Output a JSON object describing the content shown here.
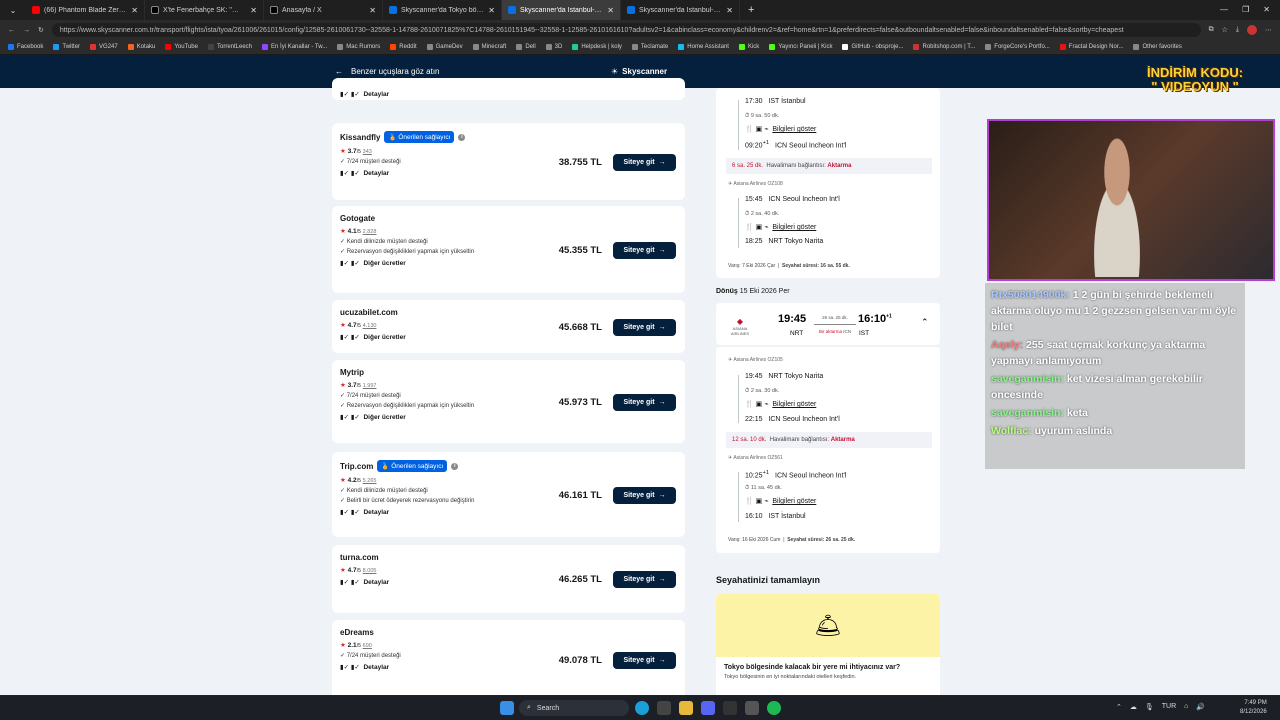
{
  "browser": {
    "tabs": [
      {
        "label": "(66) Phantom Blade Zero - Pre-Or",
        "color": "#ff0000"
      },
      {
        "label": "X'te Fenerbahçe SK: \"🎙️ Yeni tra",
        "color": "#000000"
      },
      {
        "label": "Anasayfa / X",
        "color": "#000000"
      },
      {
        "label": "Skyscanner'da Tokyo bölgesi için",
        "color": "#0770e3"
      },
      {
        "label": "Skyscanner'da İstanbul-Tokyo ara",
        "color": "#0770e3"
      },
      {
        "label": "Skyscanner'da İstanbul-Tokyo ara",
        "color": "#0770e3"
      }
    ],
    "url": "https://www.skyscanner.com.tr/transport/flights/ista/tyoa/261006/261015/config/12585-2610061730--32558-1-14788-2610071825%7C14788-2610151945--32558-1-12585-2610161610?adultsv2=1&cabinclass=economy&childrenv2=&ref=home&rtn=1&preferdirects=false&outboundaltsenabled=false&inboundaltsenabled=false&sortby=cheapest",
    "bookmarks": [
      "Facebook",
      "Twitter",
      "VG247",
      "Kotaku",
      "YouTube",
      "TorrentLeech",
      "En İyi Kanallar - Tw...",
      "Mac Rumors",
      "Reddit",
      "GameDev",
      "Minecraft",
      "Dell",
      "3D",
      "Helpdesk | koly",
      "Teclamate",
      "Home Assistant",
      "Kick",
      "Yayıncı Paneli | Kick",
      "GitHub - obsproje...",
      "Robitshop.com | T...",
      "ForgeCore's Portfo...",
      "Fractal Design Nor...",
      "Other favorites"
    ]
  },
  "header": {
    "back_label": "Benzer uçuşlara göz atın",
    "brand": "Skyscanner"
  },
  "providers": [
    {
      "name": "",
      "badge": "",
      "rating": "",
      "count": "",
      "features": [],
      "details": "Detaylar",
      "price": "",
      "cta": ""
    },
    {
      "name": "Kissandfly",
      "badge": "Önerilen sağlayıcı",
      "rating": "3.7",
      "count": "343",
      "features": [
        "7/24 müşteri desteği"
      ],
      "details": "Detaylar",
      "price": "38.755 TL",
      "cta": "Siteye git"
    },
    {
      "name": "Gotogate",
      "badge": "",
      "rating": "4.1",
      "count": "2.828",
      "features": [
        "Kendi dilinizde müşteri desteği",
        "Rezervasyon değişiklikleri yapmak için yükseltin"
      ],
      "details": "Diğer ücretler",
      "price": "45.355 TL",
      "cta": "Siteye git"
    },
    {
      "name": "ucuzabilet.com",
      "badge": "",
      "rating": "4.7",
      "count": "4.130",
      "features": [],
      "details": "Diğer ücretler",
      "price": "45.668 TL",
      "cta": "Siteye git"
    },
    {
      "name": "Mytrip",
      "badge": "",
      "rating": "3.7",
      "count": "1.997",
      "features": [
        "7/24 müşteri desteği",
        "Rezervasyon değişiklikleri yapmak için yükseltin"
      ],
      "details": "Diğer ücretler",
      "price": "45.973 TL",
      "cta": "Siteye git"
    },
    {
      "name": "Trip.com",
      "badge": "Önerilen sağlayıcı",
      "rating": "4.2",
      "count": "5.265",
      "features": [
        "Kendi dilinizde müşteri desteği",
        "Belirli bir ücret ödeyerek rezervasyonu değiştirin"
      ],
      "details": "Detaylar",
      "price": "46.161 TL",
      "cta": "Siteye git"
    },
    {
      "name": "turna.com",
      "badge": "",
      "rating": "4.7",
      "count": "8.005",
      "features": [],
      "details": "Detaylar",
      "price": "46.265 TL",
      "cta": "Siteye git"
    },
    {
      "name": "eDreams",
      "badge": "",
      "rating": "2.1",
      "count": "690",
      "features": [
        "7/24 müşteri desteği"
      ],
      "details": "Detaylar",
      "price": "49.078 TL",
      "cta": "Siteye git"
    }
  ],
  "rating_suffix": "/5",
  "outbound": {
    "seg1": {
      "dep_time": "17:30",
      "dep": "IST İstanbul",
      "dur": "9 sa. 50 dk.",
      "info": "Bilgileri göster",
      "arr_time": "09:20",
      "arr_sup": "+1",
      "arr": "ICN Seoul Incheon Int'l"
    },
    "conn": {
      "time": "6 sa. 25 dk.",
      "label": "Havalimanı bağlantısı",
      "type": "Aktarma"
    },
    "seg2": {
      "airline": "Asiana Airlines OZ108",
      "dep_time": "15:45",
      "dep": "ICN Seoul Incheon Int'l",
      "dur": "2 sa. 40 dk.",
      "info": "Bilgileri göster",
      "arr_time": "18:25",
      "arr": "NRT Tokyo Narita"
    },
    "footer_arr": "Varış: 7 Eki 2026 Çar",
    "footer_dur": "Seyahat süresi: 16 sa. 55 dk."
  },
  "inbound": {
    "title": "Dönüş",
    "date": "15 Eki 2026 Per",
    "summary": {
      "dep_time": "19:45",
      "dep": "NRT",
      "dur": "26 sa. 25 dk.",
      "stops": "Bir aktarma",
      "via": "ICN",
      "arr_time": "16:10",
      "arr_sup": "+1",
      "arr": "IST",
      "logo": "ASIANA AIRLINES"
    },
    "seg1": {
      "airline": "Asiana Airlines OZ105",
      "dep_time": "19:45",
      "dep": "NRT Tokyo Narita",
      "dur": "2 sa. 30 dk.",
      "info": "Bilgileri göster",
      "arr_time": "22:15",
      "arr": "ICN Seoul Incheon Int'l"
    },
    "conn": {
      "time": "12 sa. 10 dk.",
      "label": "Havalimanı bağlantısı",
      "type": "Aktarma"
    },
    "seg2": {
      "airline": "Asiana Airlines OZ561",
      "dep_time": "10:25",
      "dep_sup": "+1",
      "dep": "ICN Seoul Incheon Int'l",
      "dur": "11 sa. 45 dk.",
      "info": "Bilgileri göster",
      "arr_time": "16:10",
      "arr": "IST İstanbul"
    },
    "footer_arr": "Varış: 16 Eki 2026 Cum",
    "footer_dur": "Seyahat süresi: 26 sa. 25 dk."
  },
  "promo": {
    "section": "Seyahatinizi tamamlayın",
    "title": "Tokyo bölgesinde kalacak bir yere mi ihtiyacınız var?",
    "sub": "Tokyo bölgesinin en iyi noktalarındaki otelleri keşfedin."
  },
  "overlay": {
    "discount": "İNDİRİM KODU:",
    "code": "\" VIDEOYUN \"",
    "chat": [
      {
        "user": "Rtx508014900k:",
        "color": "#a9c7ff",
        "text": "1 2 gün bi şehirde beklemeli aktarma oluyo mu 1 2 gezzsen gelsen var mı öyle bilet"
      },
      {
        "user": "Aqely:",
        "color": "#ff7a7a",
        "text": "255 saat uçmak korkunç ya aktarma yapmayı anlamıyorum"
      },
      {
        "user": "saveganmisin:",
        "color": "#7dff7d",
        "text": "ket vizesi alman gerekebilir oncesinde"
      },
      {
        "user": "saveganmisin:",
        "color": "#7dff7d",
        "text": "keta"
      },
      {
        "user": "Wolflac:",
        "color": "#b8ff7a",
        "text": "uyurum aslında"
      }
    ]
  },
  "taskbar": {
    "search": "Search",
    "lang": "TUR",
    "time": "7:49 PM",
    "date": "8/12/2026"
  }
}
